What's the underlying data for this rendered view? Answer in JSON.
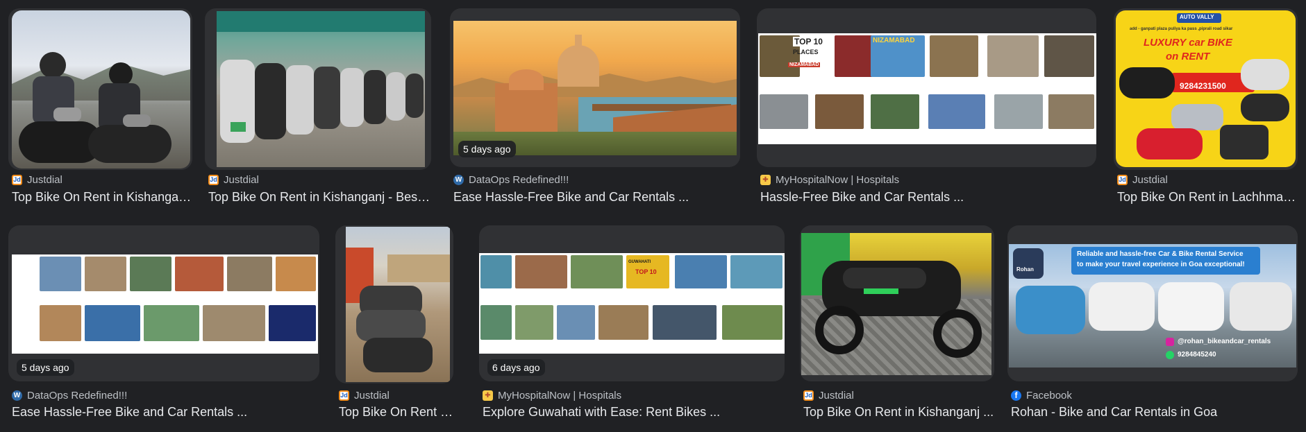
{
  "results": [
    {
      "source": "Justdial",
      "favicon": "justdial-icon",
      "title": "Top Bike On Rent in Kishanganj - Best ...",
      "age": ""
    },
    {
      "source": "Justdial",
      "favicon": "justdial-icon",
      "title": "Top Bike On Rent in Kishanganj - Best ...",
      "age": ""
    },
    {
      "source": "DataOps Redefined!!!",
      "favicon": "wordpress-icon",
      "title": "Ease Hassle-Free Bike and Car Rentals ...",
      "age": "5 days ago"
    },
    {
      "source": "MyHospitalNow | Hospitals",
      "favicon": "myhospitalnow-icon",
      "title": "Hassle-Free Bike and Car Rentals ...",
      "age": "",
      "image_text": [
        "TOP 10",
        "PLACES",
        "NIZAMABAD",
        "NIZAMABAD"
      ]
    },
    {
      "source": "Justdial",
      "favicon": "justdial-icon",
      "title": "Top Bike On Rent in Lachhmangarh ...",
      "age": "",
      "image_text": [
        "AUTO VALLY",
        "add - ganpati plaza puliya ka pass ,piprali road sikar",
        "LUXURY car BIKE",
        "on RENT",
        "9284231500"
      ]
    },
    {
      "source": "DataOps Redefined!!!",
      "favicon": "wordpress-icon",
      "title": "Ease Hassle-Free Bike and Car Rentals ...",
      "age": "5 days ago"
    },
    {
      "source": "Justdial",
      "favicon": "justdial-icon",
      "title": "Top Bike On Rent in Kishanganj ...",
      "age": ""
    },
    {
      "source": "MyHospitalNow | Hospitals",
      "favicon": "myhospitalnow-icon",
      "title": "Explore Guwahati with Ease: Rent Bikes ...",
      "age": "6 days ago",
      "image_text": [
        "GUWAHATI",
        "TOP 10"
      ]
    },
    {
      "source": "Justdial",
      "favicon": "justdial-icon",
      "title": "Top Bike On Rent in Kishanganj ...",
      "age": ""
    },
    {
      "source": "Facebook",
      "favicon": "facebook-icon",
      "title": "Rohan - Bike and Car Rentals in Goa",
      "age": "",
      "image_text": [
        "Reliable and hassle-free Car & Bike Rental Service",
        "to make your travel experience in Goa exceptional!",
        "@rohan_bikeandcar_rentals",
        "9284845240",
        "Rohan"
      ]
    }
  ],
  "colors": {
    "background": "#202124",
    "title_text": "#e8eaed",
    "source_text": "#bdc1c6",
    "thumb_bg": "#303134"
  }
}
